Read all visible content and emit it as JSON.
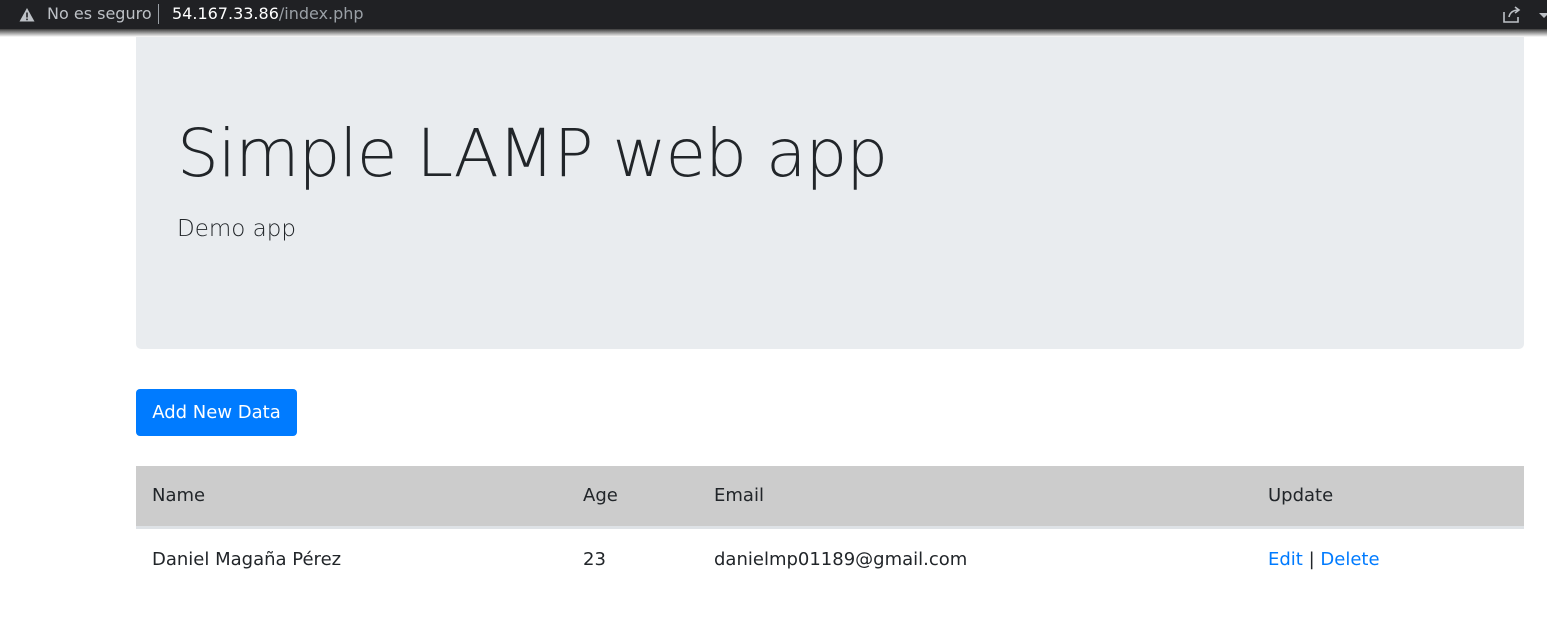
{
  "browser": {
    "security_label": "No es seguro",
    "url_host": "54.167.33.86",
    "url_path": "/index.php"
  },
  "jumbotron": {
    "title": "Simple LAMP web app",
    "subtitle": "Demo app"
  },
  "actions": {
    "add_label": "Add New Data"
  },
  "table": {
    "headers": [
      "Name",
      "Age",
      "Email",
      "Update"
    ],
    "rows": [
      {
        "name": "Daniel Magaña Pérez",
        "age": "23",
        "email": "danielmp01189@gmail.com",
        "edit_label": "Edit",
        "separator": "|",
        "delete_label": "Delete"
      }
    ]
  },
  "colors": {
    "primary": "#007bff",
    "jumbotron_bg": "#e9ecef",
    "table_header_bg": "#cccccc",
    "browser_bar": "#202124"
  },
  "icons": {
    "security": "warning-triangle-icon",
    "share": "share-icon"
  }
}
